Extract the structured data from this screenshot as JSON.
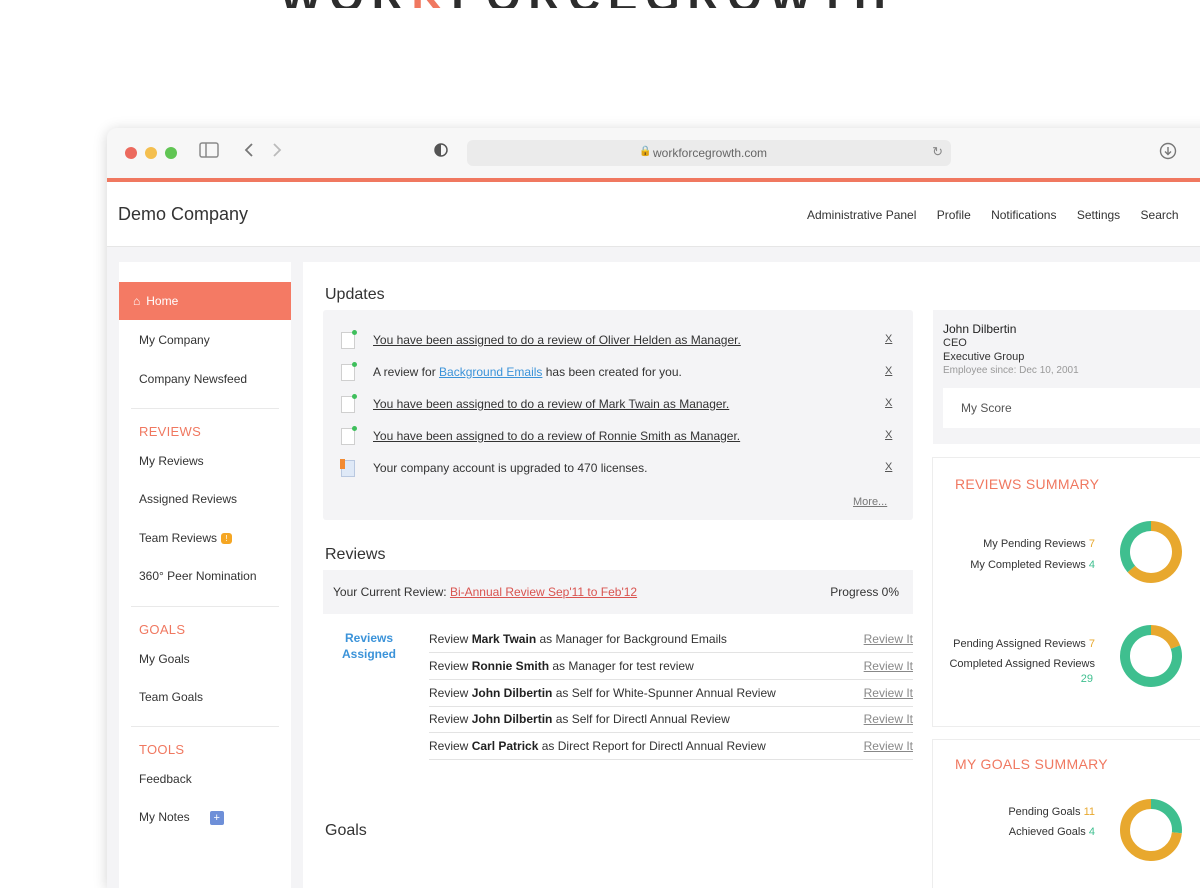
{
  "brand": {
    "left": "WOR",
    "accent": "K",
    "right": "FORCEGROWTH"
  },
  "browser": {
    "url": "workforcegrowth.com"
  },
  "header": {
    "company": "Demo Company",
    "nav": [
      "Administrative Panel",
      "Profile",
      "Notifications",
      "Settings",
      "Search"
    ]
  },
  "sidebar": {
    "home": "Home",
    "items": [
      "My Company",
      "Company Newsfeed"
    ],
    "reviews_title": "REVIEWS",
    "reviews_items": [
      "My Reviews",
      "Assigned Reviews",
      "Team Reviews",
      "360° Peer Nomination"
    ],
    "goals_title": "GOALS",
    "goals_items": [
      "My Goals",
      "Team Goals"
    ],
    "tools_title": "TOOLS",
    "tools_items": [
      "Feedback",
      "My Notes"
    ]
  },
  "updates": {
    "title": "Updates",
    "rows": [
      {
        "text": "You have been assigned to do a review of Oliver Helden as Manager."
      },
      {
        "pre": "A review for ",
        "link": "Background Emails",
        "post": " has been created for you."
      },
      {
        "text": "You have been assigned to do a review of Mark Twain as Manager."
      },
      {
        "text": "You have been assigned to do a review of Ronnie Smith as Manager."
      },
      {
        "text": "Your company account is upgraded to 470 licenses."
      }
    ],
    "close": "X",
    "more": "More..."
  },
  "reviews": {
    "title": "Reviews",
    "current_label": "Your Current Review: ",
    "current_review": "Bi-Annual Review Sep'11 to Feb'12",
    "progress": "Progress 0%",
    "assigned_label": "Reviews Assigned",
    "action": "Review It",
    "rows": [
      {
        "pre": "Review ",
        "name": "Mark Twain",
        "post": " as Manager for Background Emails"
      },
      {
        "pre": "Review ",
        "name": "Ronnie Smith",
        "post": " as Manager for test review"
      },
      {
        "pre": "Review ",
        "name": "John Dilbertin",
        "post": " as Self for White-Spunner Annual Review"
      },
      {
        "pre": "Review ",
        "name": "John Dilbertin",
        "post": " as Self for Directl Annual Review"
      },
      {
        "pre": "Review ",
        "name": "Carl Patrick",
        "post": " as Direct Report for Directl Annual Review"
      }
    ]
  },
  "goals": {
    "title": "Goals"
  },
  "profile": {
    "name": "John Dilbertin",
    "title": "CEO",
    "group": "Executive Group",
    "since": "Employee since: Dec 10, 2001",
    "score": "My Score"
  },
  "reviews_summary": {
    "title": "REVIEWS SUMMARY",
    "pending_label": "My Pending Reviews",
    "pending": "7",
    "completed_label": "My Completed Reviews",
    "completed": "4",
    "assigned_pending_label": "Pending Assigned Reviews",
    "assigned_pending": "7",
    "assigned_completed_label": "Completed Assigned Reviews",
    "assigned_completed": "29"
  },
  "goals_summary": {
    "title": "MY GOALS SUMMARY",
    "pending_label": "Pending Goals",
    "pending": "11",
    "achieved_label": "Achieved Goals",
    "achieved": "4"
  },
  "colors": {
    "accent": "#f07860",
    "pending": "#e8a82e",
    "completed": "#3fbf8f",
    "link": "#3b93d9"
  }
}
